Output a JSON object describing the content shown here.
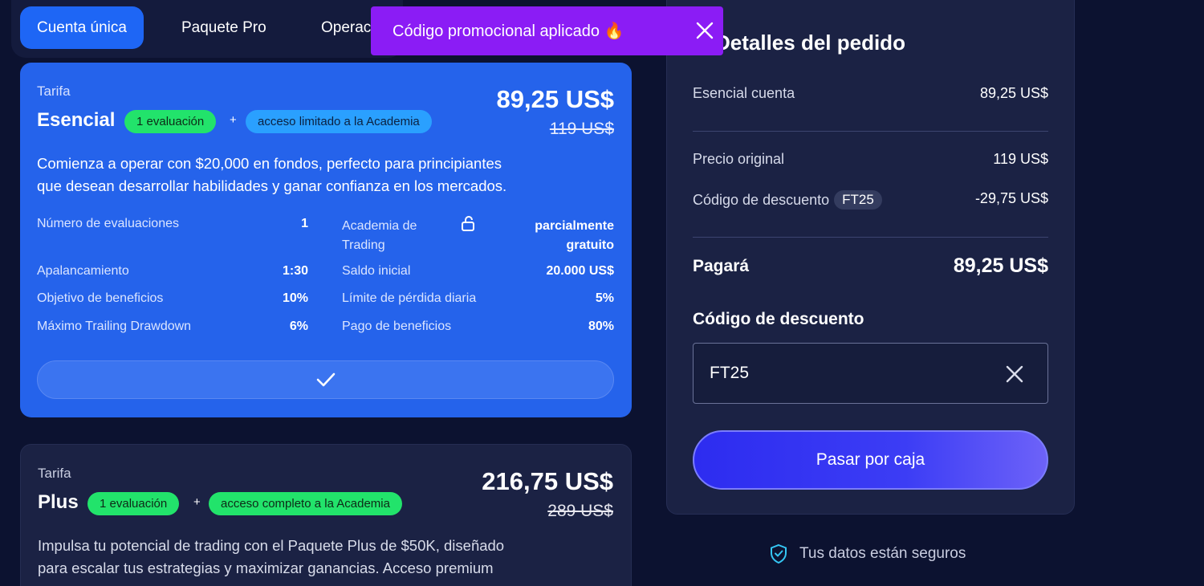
{
  "tabs": [
    {
      "label": "Cuenta única",
      "active": true
    },
    {
      "label": "Paquete Pro",
      "active": false
    },
    {
      "label": "Operac",
      "active": false
    }
  ],
  "toast": {
    "message": "Código promocional aplicado 🔥"
  },
  "plans": [
    {
      "tarifa_label": "Tarifa",
      "name": "Esencial",
      "evaluation_badge": "1 evaluación",
      "plus": "+",
      "academy_badge": "acceso limitado a la Academia",
      "price": "89,25 US$",
      "old_price": "119 US$",
      "description": "Comienza a operar con $20,000 en fondos, perfecto para principiantes que desean desarrollar habilidades y ganar confianza en los mercados.",
      "specs": {
        "evaluaciones_label": "Número de evaluaciones",
        "evaluaciones_value": "1",
        "apalancamiento_label": "Apalancamiento",
        "apalancamiento_value": "1:30",
        "objetivo_label": "Objetivo de beneficios",
        "objetivo_value": "10%",
        "drawdown_label": "Máximo Trailing Drawdown",
        "drawdown_value": "6%",
        "academia_label": "Academia de Trading",
        "academia_value": "parcialmente gratuito",
        "saldo_label": "Saldo inicial",
        "saldo_value": "20.000 US$",
        "perdida_label": "Límite de pérdida diaria",
        "perdida_value": "5%",
        "pago_label": "Pago de beneficios",
        "pago_value": "80%"
      },
      "selected": true
    },
    {
      "tarifa_label": "Tarifa",
      "name": "Plus",
      "evaluation_badge": "1 evaluación",
      "plus": "+",
      "academy_badge": "acceso completo a la Academia",
      "price": "216,75 US$",
      "old_price": "289 US$",
      "description": "Impulsa tu potencial de trading con el Paquete Plus de $50K, diseñado para escalar tus estrategias y maximizar ganancias. Acceso premium"
    }
  ],
  "order": {
    "title": "Detalles del pedido",
    "account_label": "Esencial cuenta",
    "account_value": "89,25 US$",
    "original_label": "Precio original",
    "original_value": "119 US$",
    "discount_label": "Código de descuento",
    "discount_code": "FT25",
    "discount_value": "-29,75 US$",
    "pay_label": "Pagará",
    "pay_value": "89,25 US$",
    "discount_field_label": "Código de descuento",
    "discount_input_value": "FT25",
    "checkout_label": "Pasar por caja"
  },
  "secure_text": "Tus datos están seguros",
  "colors": {
    "accent": "#2563eb",
    "toast": "#8b1cf5",
    "green_badge": "#22e36b",
    "blue_badge": "#2aa0ff",
    "checkout": "#3c3df5"
  }
}
